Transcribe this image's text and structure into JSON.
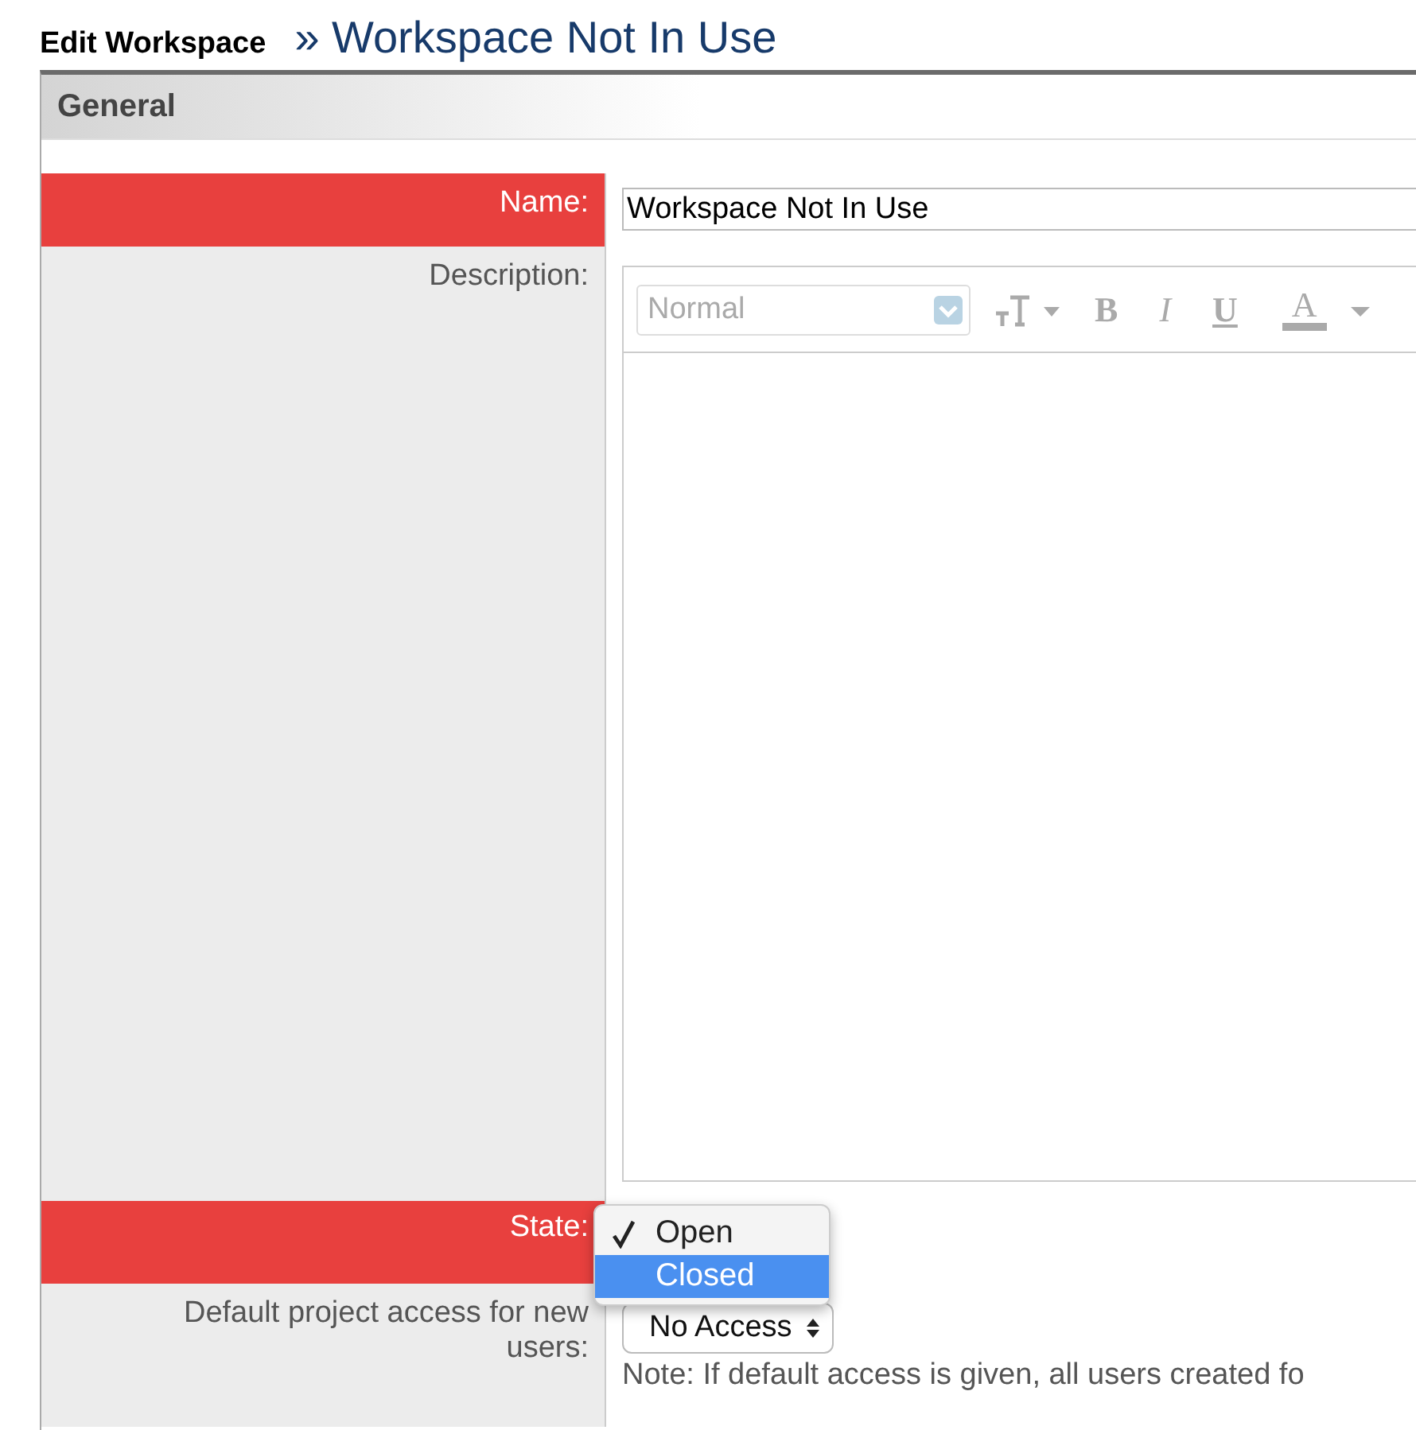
{
  "page": {
    "breadcrumb": "Edit Workspace",
    "title": "» Workspace Not In Use"
  },
  "section": {
    "title": "General"
  },
  "fields": [
    {
      "kind": "text",
      "label": "Name:",
      "required": true,
      "value": "Workspace Not In Use"
    },
    {
      "kind": "editor",
      "label": "Description:",
      "required": false,
      "format": "Normal",
      "tools": [
        "B",
        "I",
        "U",
        "A"
      ]
    },
    {
      "kind": "menu",
      "label": "State:",
      "required": true,
      "options": [
        {
          "label": "Open",
          "checked": true,
          "highlighted": false
        },
        {
          "label": "Closed",
          "checked": false,
          "highlighted": true
        }
      ]
    },
    {
      "kind": "select",
      "label": "Default project access for new users:",
      "required": false,
      "value": "No Access",
      "note": "Note: If default access is given, all users created fo"
    }
  ]
}
